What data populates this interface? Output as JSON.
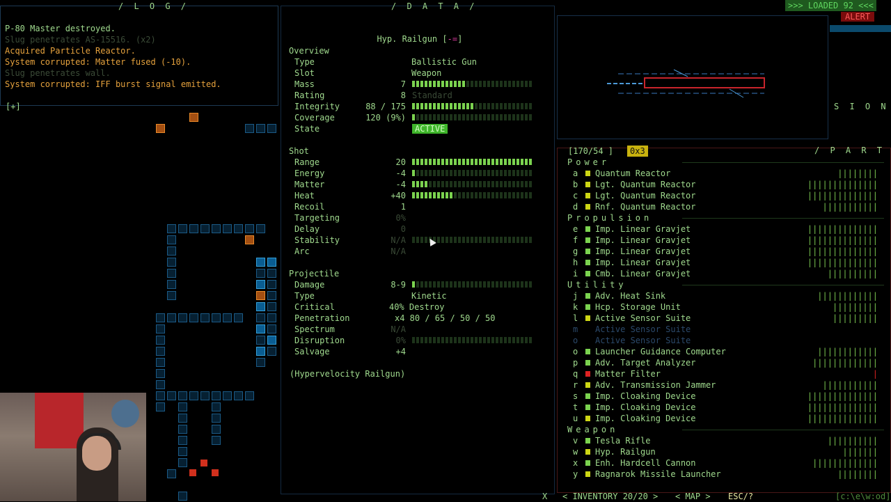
{
  "log": {
    "title": "/ L O G /",
    "lines": [
      {
        "text": "P-80 Master destroyed.",
        "tone": "green"
      },
      {
        "text": "Slug penetrates AS-15516. (x2)",
        "tone": "dim"
      },
      {
        "text": "Acquired Particle Reactor.",
        "tone": "orange"
      },
      {
        "text": "System corrupted: Matter fused (-10).",
        "tone": "orange"
      },
      {
        "text": "Slug penetrates wall.",
        "tone": "dim"
      },
      {
        "text": "System corrupted: IFF burst signal emitted.",
        "tone": "orange"
      }
    ],
    "expand": "[+]"
  },
  "data": {
    "title": "/ D A T A /",
    "item_name": "Hyp. Railgun [",
    "item_name_end": "]",
    "sections": {
      "overview": "Overview",
      "shot": "Shot",
      "projectile": "Projectile"
    },
    "overview": {
      "type_label": "Type",
      "type_value": "Ballistic Gun",
      "slot_label": "Slot",
      "slot_value": "Weapon",
      "mass_label": "Mass",
      "mass_value": "7",
      "rating_label": "Rating",
      "rating_value": "8",
      "rating_note": "Standard",
      "integrity_label": "Integrity",
      "integrity_value": "88 / 175",
      "coverage_label": "Coverage",
      "coverage_value": "120 (9%)",
      "state_label": "State",
      "state_value": "ACTIVE"
    },
    "shot": {
      "range_label": "Range",
      "range_value": "20",
      "energy_label": "Energy",
      "energy_value": "-4",
      "matter_label": "Matter",
      "matter_value": "-4",
      "heat_label": "Heat",
      "heat_value": "+40",
      "recoil_label": "Recoil",
      "recoil_value": "1",
      "targeting_label": "Targeting",
      "targeting_value": "0%",
      "delay_label": "Delay",
      "delay_value": "0",
      "stability_label": "Stability",
      "stability_value": "N/A",
      "arc_label": "Arc",
      "arc_value": "N/A"
    },
    "projectile": {
      "damage_label": "Damage",
      "damage_value": "8-9",
      "type_label": "Type",
      "type_value": "Kinetic",
      "critical_label": "Critical",
      "critical_value": "40% Destroy",
      "penetration_label": "Penetration",
      "penetration_value": "x4 80 / 65 / 50 / 50",
      "spectrum_label": "Spectrum",
      "spectrum_value": "N/A",
      "disruption_label": "Disruption",
      "disruption_value": "0%",
      "salvage_label": "Salvage",
      "salvage_value": "+4"
    },
    "footer_name": "(Hypervelocity Railgun)",
    "bars": {
      "mass": 0.45,
      "integrity": 0.5,
      "coverage": 0.04,
      "range": 1.0,
      "energy": 0.04,
      "matter": 0.14,
      "heat": 0.36,
      "damage": 0.04
    }
  },
  "top_right": {
    "loaded": ">>> LOADED 92 <<<",
    "alert": "ALERT",
    "vision_title": "S I O N /"
  },
  "parts": {
    "header_left": "[170/54 ]",
    "header_badge": "0x3",
    "title": "/ P A R T S /",
    "categories": {
      "power": "Power",
      "propulsion": "Propulsion",
      "utility": "Utility",
      "weapon": "Weapon"
    },
    "items": [
      {
        "key": "a",
        "name": "Quantum Reactor",
        "ticks": "||||||||",
        "mark": "#cdd614"
      },
      {
        "key": "b",
        "name": "Lgt. Quantum Reactor",
        "ticks": "||||||||||||||",
        "mark": "#cdd614"
      },
      {
        "key": "c",
        "name": "Lgt. Quantum Reactor",
        "ticks": "||||||||||||||",
        "mark": "#cdd614"
      },
      {
        "key": "d",
        "name": "Rnf. Quantum Reactor",
        "ticks": "|||||||||||",
        "mark": "#cdd614"
      },
      {
        "key": "e",
        "name": "Imp. Linear Gravjet",
        "ticks": "||||||||||||||",
        "mark": "#7bd34f"
      },
      {
        "key": "f",
        "name": "Imp. Linear Gravjet",
        "ticks": "||||||||||||||",
        "mark": "#7bd34f"
      },
      {
        "key": "g",
        "name": "Imp. Linear Gravjet",
        "ticks": "||||||||||||||",
        "mark": "#7bd34f"
      },
      {
        "key": "h",
        "name": "Imp. Linear Gravjet",
        "ticks": "||||||||||||||",
        "mark": "#7bd34f"
      },
      {
        "key": "i",
        "name": "Cmb. Linear Gravjet",
        "ticks": "||||||||||",
        "mark": "#7bd34f"
      },
      {
        "key": "j",
        "name": "Adv. Heat Sink",
        "ticks": "||||||||||||",
        "mark": "#7bd34f"
      },
      {
        "key": "k",
        "name": "Hcp. Storage Unit",
        "ticks": "|||||||||",
        "mark": "#7bd34f"
      },
      {
        "key": "l",
        "name": "Active Sensor Suite",
        "ticks": "|||||||||",
        "mark": "#cdd614"
      },
      {
        "key": "m",
        "name": "Active Sensor Suite",
        "ticks": "",
        "mark": "none",
        "dim": true
      },
      {
        "key": "o",
        "name": "Active Sensor Suite",
        "ticks": "",
        "mark": "none",
        "dim": true
      },
      {
        "key": "o",
        "name": "Launcher Guidance Computer",
        "ticks": "||||||||||||",
        "mark": "#7bd34f"
      },
      {
        "key": "p",
        "name": "Adv. Target Analyzer",
        "ticks": "|||||||||||||",
        "mark": "#7bd34f"
      },
      {
        "key": "q",
        "name": "Matter Filter",
        "ticks": "|",
        "mark": "#d22"
      },
      {
        "key": "r",
        "name": "Adv. Transmission Jammer",
        "ticks": "|||||||||||",
        "mark": "#cdd614"
      },
      {
        "key": "s",
        "name": "Imp. Cloaking Device",
        "ticks": "||||||||||||||",
        "mark": "#7bd34f"
      },
      {
        "key": "t",
        "name": "Imp. Cloaking Device",
        "ticks": "||||||||||||||",
        "mark": "#7bd34f"
      },
      {
        "key": "u",
        "name": "Imp. Cloaking Device",
        "ticks": "||||||||||||||",
        "mark": "#cdd614"
      },
      {
        "key": "v",
        "name": "Tesla Rifle",
        "ticks": "||||||||||",
        "mark": "#7bd34f"
      },
      {
        "key": "w",
        "name": "Hyp. Railgun",
        "ticks": "|||||||",
        "mark": "#cdd614"
      },
      {
        "key": "x",
        "name": "Enh. Hardcell Cannon",
        "ticks": "|||||||||||||",
        "mark": "#7bd34f"
      },
      {
        "key": "y",
        "name": "Ragnarok Missile Launcher",
        "ticks": "||||||||",
        "mark": "#cdd614"
      }
    ]
  },
  "bottom_bar": {
    "close": "X",
    "inventory": "< INVENTORY 20/20 >",
    "map": "< MAP >",
    "esc": "ESC/?",
    "path": "[c:\\e\\w:od]"
  }
}
